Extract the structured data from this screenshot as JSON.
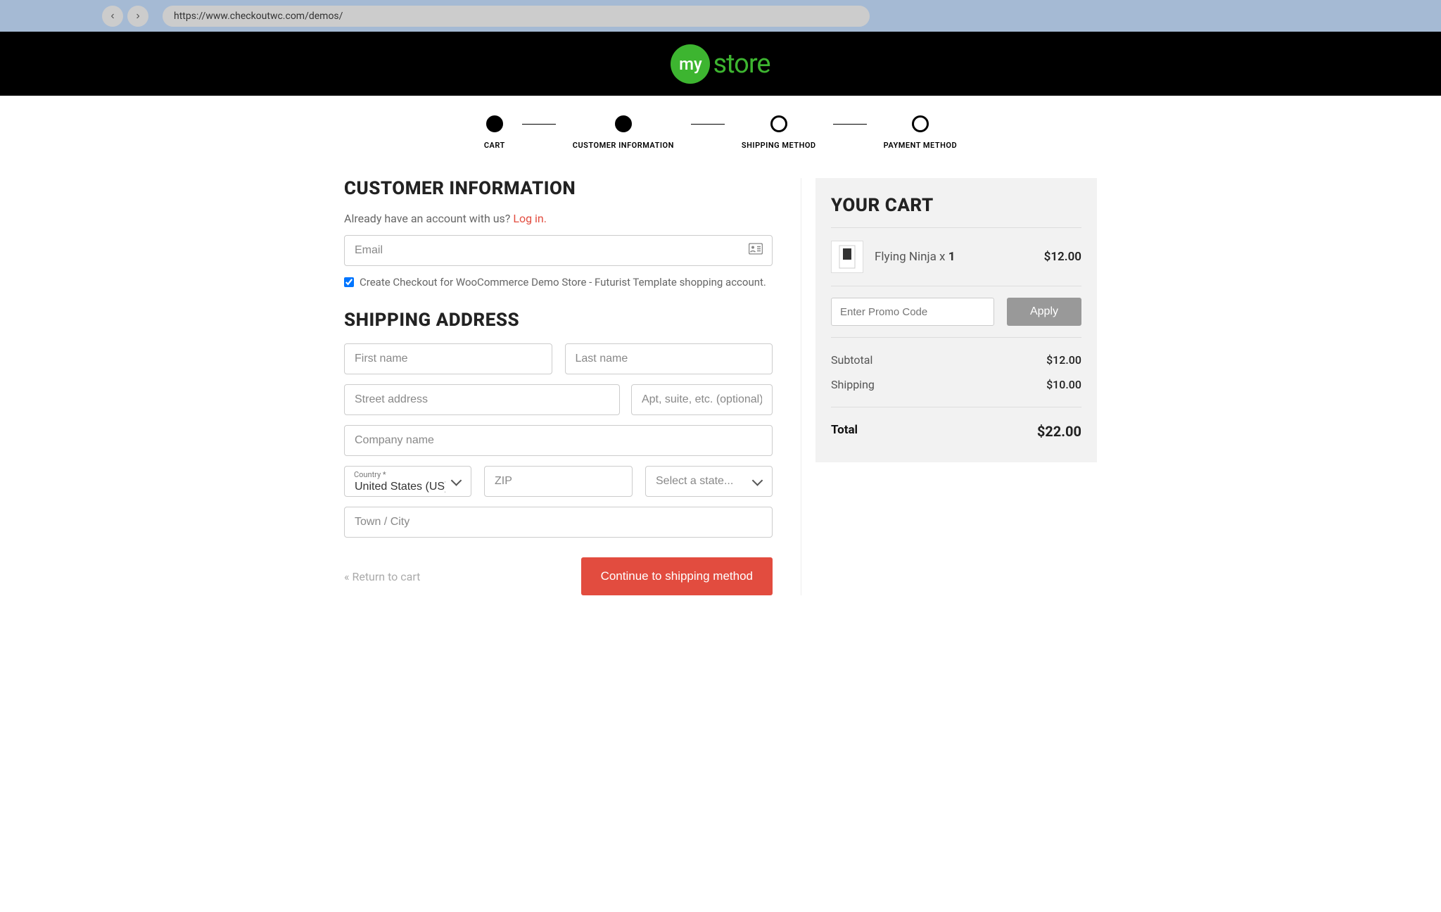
{
  "browser": {
    "url": "https://www.checkoutwc.com/demos/"
  },
  "logo": {
    "badge": "my",
    "word": "store"
  },
  "steps": [
    {
      "label": "CART",
      "filled": true
    },
    {
      "label": "CUSTOMER INFORMATION",
      "filled": true
    },
    {
      "label": "SHIPPING METHOD",
      "filled": false
    },
    {
      "label": "PAYMENT METHOD",
      "filled": false
    }
  ],
  "customer": {
    "heading": "CUSTOMER INFORMATION",
    "login_prompt": "Already have an account with us? ",
    "login_link": "Log in.",
    "email_placeholder": "Email",
    "create_account_label": "Create Checkout for WooCommerce Demo Store - Futurist Template shopping account."
  },
  "shipping": {
    "heading": "SHIPPING ADDRESS",
    "first_name_ph": "First name",
    "last_name_ph": "Last name",
    "street_ph": "Street address",
    "apt_ph": "Apt, suite, etc. (optional)",
    "company_ph": "Company name",
    "country_label": "Country *",
    "country_value": "United States (US)",
    "zip_ph": "ZIP",
    "state_ph": "Select a state...",
    "city_ph": "Town / City"
  },
  "actions": {
    "return": "« Return to cart",
    "continue": "Continue to shipping method"
  },
  "cart": {
    "heading": "YOUR CART",
    "item": {
      "name": "Flying Ninja x ",
      "qty": "1",
      "price": "$12.00"
    },
    "promo_ph": "Enter Promo Code",
    "apply": "Apply",
    "subtotal_label": "Subtotal",
    "subtotal_value": "$12.00",
    "shipping_label": "Shipping",
    "shipping_value": "$10.00",
    "total_label": "Total",
    "total_value": "$22.00"
  }
}
